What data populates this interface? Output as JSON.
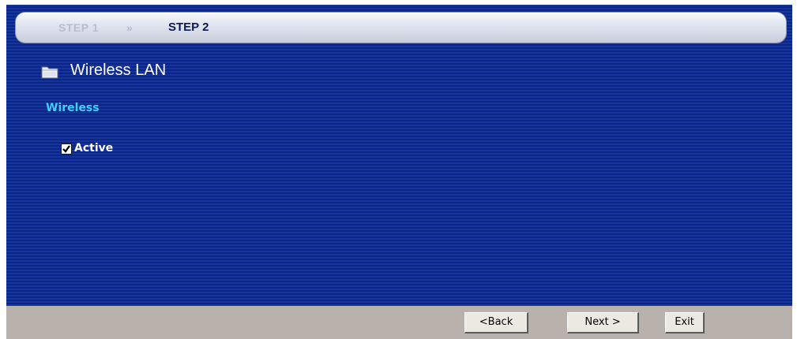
{
  "steps": {
    "previous": "STEP 1",
    "separator": "»",
    "current": "STEP 2"
  },
  "page": {
    "title": "Wireless LAN",
    "title_icon": "folder-icon"
  },
  "section": {
    "label": "Wireless"
  },
  "active_checkbox": {
    "label": "Active",
    "checked": true
  },
  "footer": {
    "back_label": "<Back",
    "next_label": "Next >",
    "exit_label": "Exit"
  },
  "colors": {
    "panel_bg": "#0e2a8f",
    "section_label": "#3fd0ff",
    "footer_bg": "#b9b2ac"
  }
}
